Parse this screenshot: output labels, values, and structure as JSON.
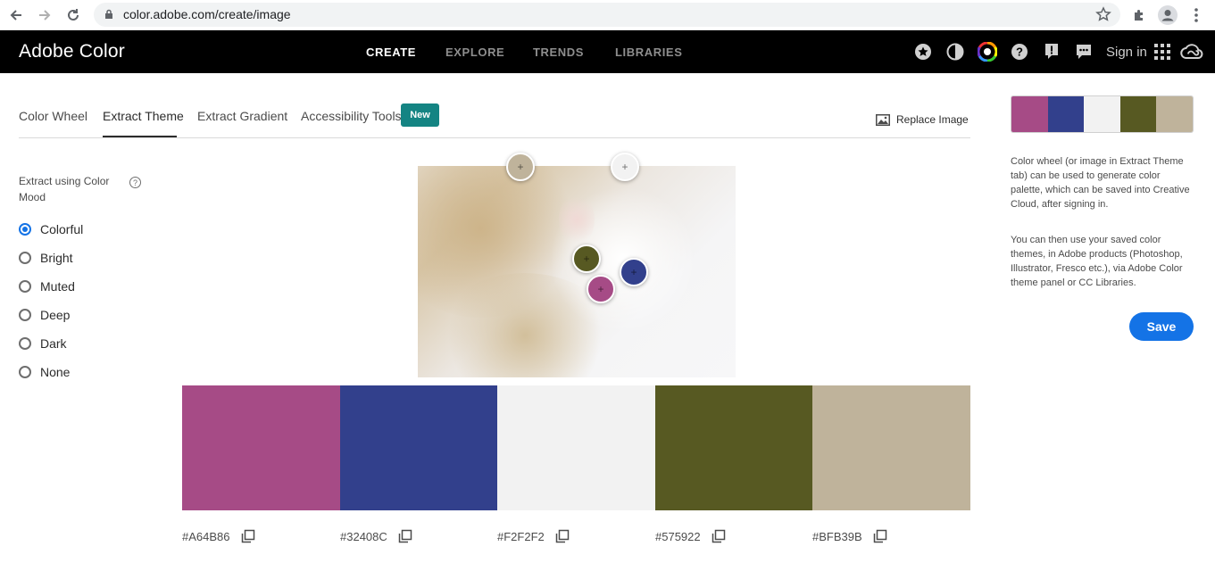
{
  "browser": {
    "url": "color.adobe.com/create/image"
  },
  "header": {
    "app_title": "Adobe Color",
    "nav": [
      {
        "label": "CREATE",
        "active": true
      },
      {
        "label": "EXPLORE",
        "active": false
      },
      {
        "label": "TRENDS",
        "active": false
      },
      {
        "label": "LIBRARIES",
        "active": false
      }
    ],
    "sign_in": "Sign in"
  },
  "tabs": {
    "items": [
      "Color Wheel",
      "Extract Theme",
      "Extract Gradient",
      "Accessibility Tools"
    ],
    "active": "Extract Theme",
    "new_badge": "New",
    "replace_image": "Replace Image"
  },
  "mood": {
    "title": "Extract using Color Mood",
    "options": [
      "Colorful",
      "Bright",
      "Muted",
      "Deep",
      "Dark",
      "None"
    ],
    "selected": "Colorful"
  },
  "palette": {
    "colors": [
      "#A64B86",
      "#32408C",
      "#F2F2F2",
      "#575922",
      "#BFB39B"
    ],
    "labels": [
      "#A64B86",
      "#32408C",
      "#F2F2F2",
      "#575922",
      "#BFB39B"
    ]
  },
  "right_panel": {
    "info_1": "Color wheel (or image in Extract Theme tab) can be used to generate color palette, which can be saved into Creative Cloud, after signing in.",
    "info_2": "You can then use your saved color themes, in Adobe products (Photoshop, Illustrator, Fresco etc.), via Adobe Color theme panel or CC Libraries.",
    "save_label": "Save"
  }
}
